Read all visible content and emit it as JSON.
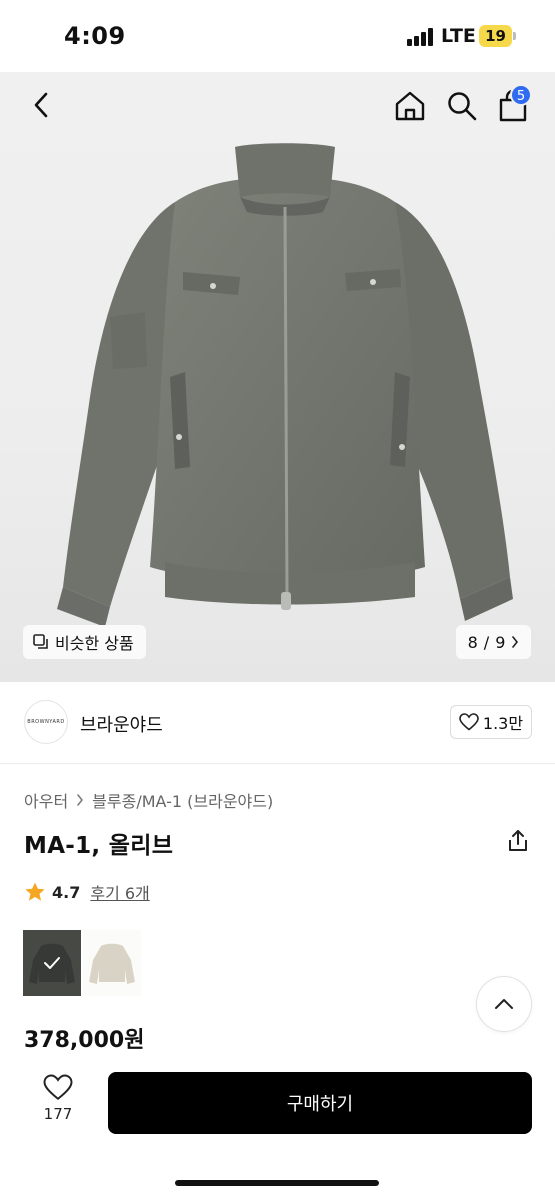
{
  "status_bar": {
    "time": "4:09",
    "network": "LTE",
    "battery": "19"
  },
  "header": {
    "cart_count": "5"
  },
  "gallery": {
    "similar_label": "비슷한 상품",
    "current_page": "8",
    "total_pages": "9",
    "page_separator": "/"
  },
  "brand": {
    "logo_text": "BROWNYARD",
    "name": "브라운야드",
    "likes": "1.3만"
  },
  "breadcrumb": {
    "category": "아우터",
    "subcategory": "블루종/MA-1 (브라운야드)"
  },
  "product": {
    "title": "MA-1, 올리브",
    "rating": "4.7",
    "review_label": "후기 6개",
    "price": "378,000원",
    "colors": {
      "selected": "#6b6e67",
      "alternate": "#d8d3c4",
      "star": "#f5a623",
      "buy_button": "#000000",
      "cart_badge": "#2f6cf0"
    }
  },
  "bottom_bar": {
    "wish_count": "177",
    "buy_label": "구매하기"
  }
}
